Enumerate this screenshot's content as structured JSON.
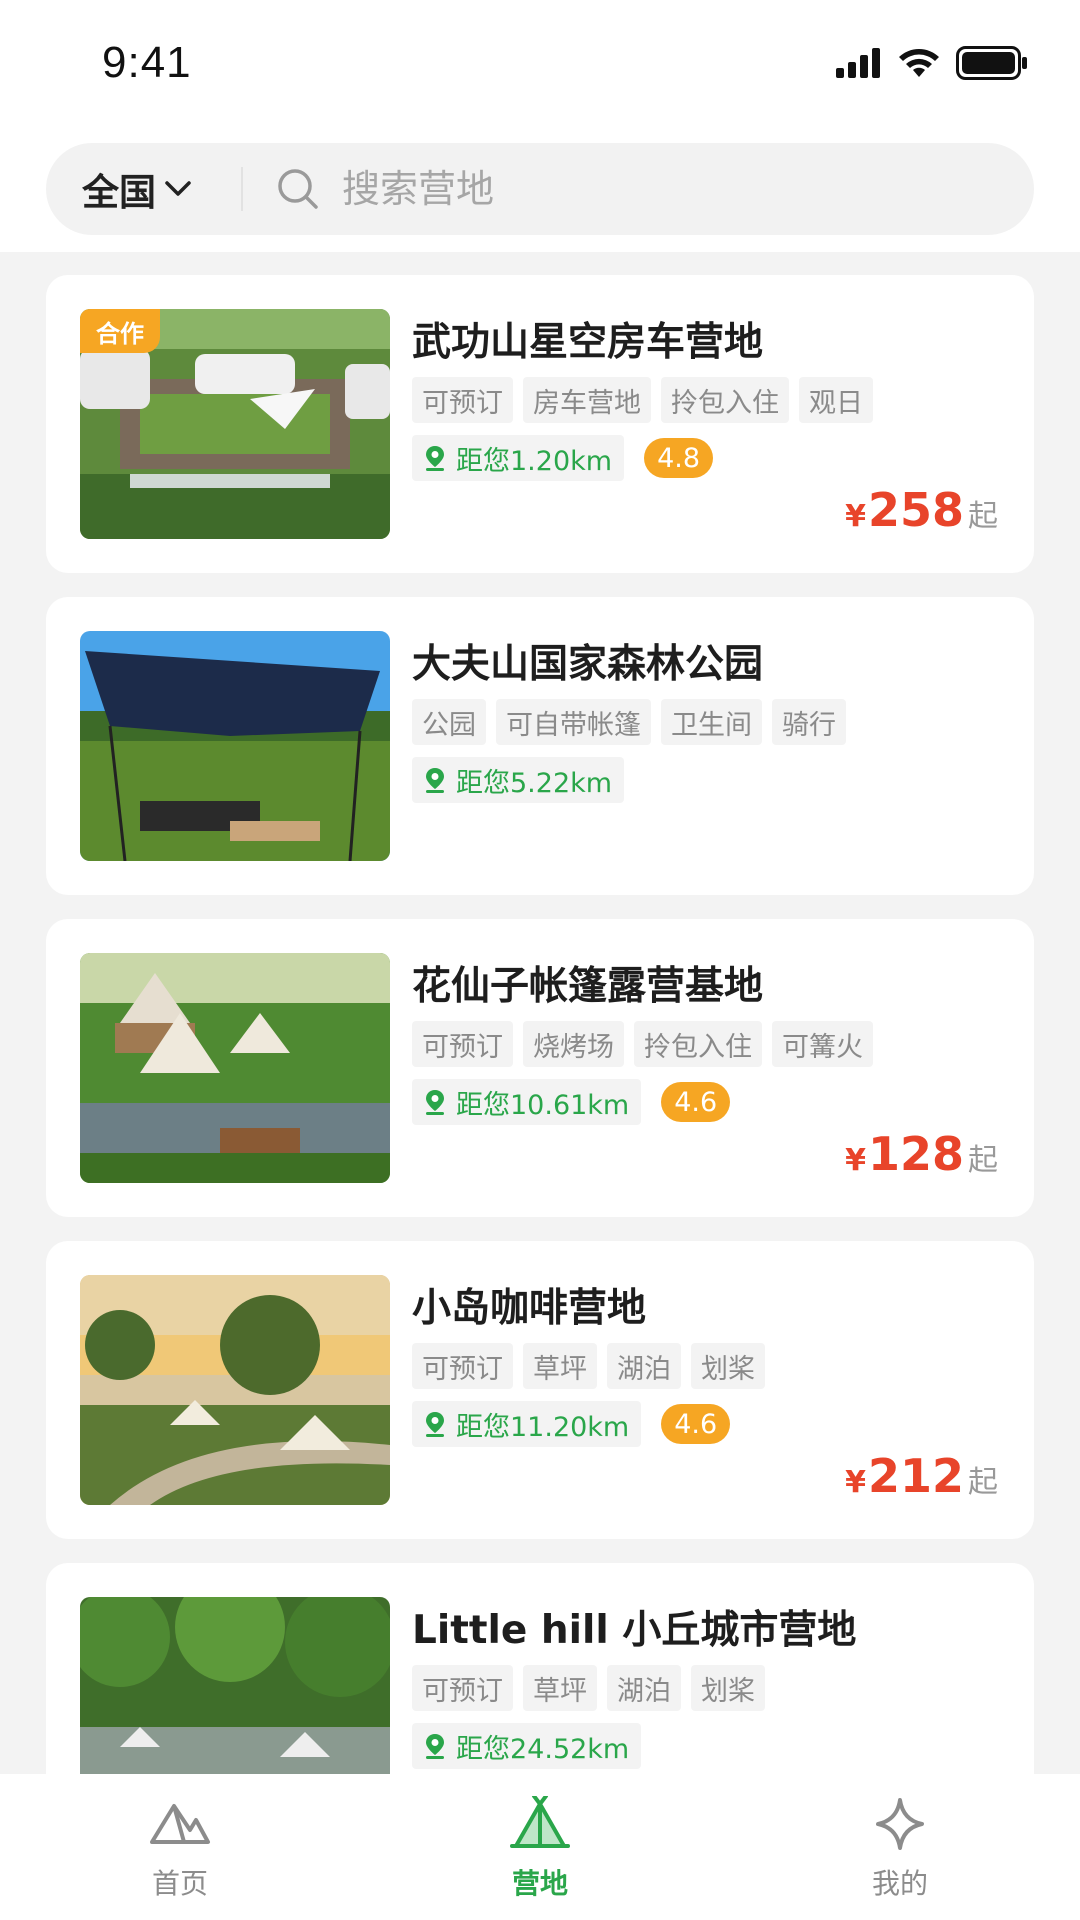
{
  "status_bar": {
    "time": "9:41"
  },
  "header": {
    "region": "全国",
    "search_placeholder": "搜索营地"
  },
  "camps": [
    {
      "title": "武功山星空房车营地",
      "badge": "合作",
      "tags": [
        "可预订",
        "房车营地",
        "拎包入住",
        "观日"
      ],
      "distance": "距您1.20km",
      "rating": "4.8",
      "price": {
        "symbol": "¥",
        "value": "258",
        "suffix": "起"
      },
      "image": "rv-camp-photo"
    },
    {
      "title": "大夫山国家森林公园",
      "badge": "",
      "tags": [
        "公园",
        "可自带帐篷",
        "卫生间",
        "骑行"
      ],
      "distance": "距您5.22km",
      "rating": "",
      "price": {
        "symbol": "",
        "value": "",
        "suffix": ""
      },
      "image": "canopy-lawn-photo"
    },
    {
      "title": "花仙子帐篷露营基地",
      "badge": "",
      "tags": [
        "可预订",
        "烧烤场",
        "拎包入住",
        "可篝火"
      ],
      "distance": "距您10.61km",
      "rating": "4.6",
      "price": {
        "symbol": "¥",
        "value": "128",
        "suffix": "起"
      },
      "image": "tent-garden-photo"
    },
    {
      "title": "小岛咖啡营地",
      "badge": "",
      "tags": [
        "可预订",
        "草坪",
        "湖泊",
        "划桨"
      ],
      "distance": "距您11.20km",
      "rating": "4.6",
      "price": {
        "symbol": "¥",
        "value": "212",
        "suffix": "起"
      },
      "image": "lakeside-sunset-photo"
    },
    {
      "title": "Little hill 小丘城市营地",
      "badge": "",
      "tags": [
        "可预订",
        "草坪",
        "湖泊",
        "划桨"
      ],
      "distance": "距您24.52km",
      "rating": "",
      "price": {
        "symbol": "",
        "value": "",
        "suffix": ""
      },
      "image": "forest-aerial-photo"
    }
  ],
  "tabbar": {
    "items": [
      {
        "label": "首页",
        "icon": "mountain-icon",
        "active": false
      },
      {
        "label": "营地",
        "icon": "tent-icon",
        "active": true
      },
      {
        "label": "我的",
        "icon": "sparkle-icon",
        "active": false
      }
    ]
  },
  "colors": {
    "accent_green": "#2aa64a",
    "price_red": "#e8442a",
    "rating_orange": "#f6a623"
  }
}
